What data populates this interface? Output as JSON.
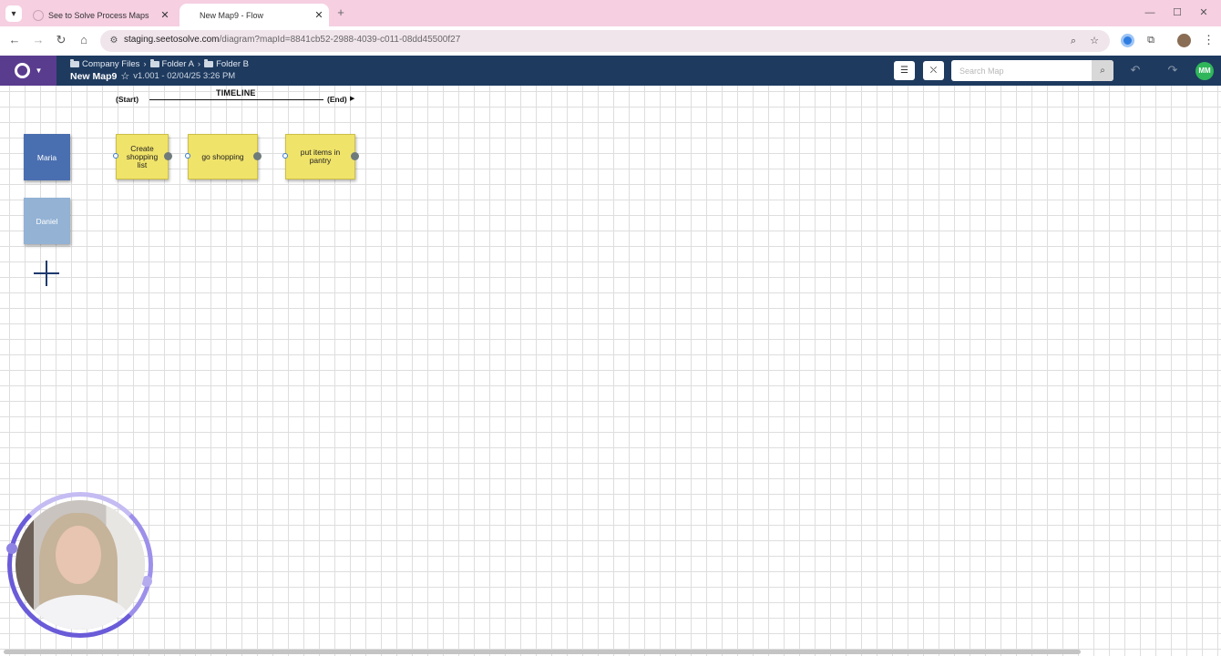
{
  "browser": {
    "tabs": [
      {
        "title": "See to Solve Process Maps",
        "active": false
      },
      {
        "title": "New Map9 - Flow",
        "active": true
      }
    ],
    "url_host": "staging.seetosolve.com",
    "url_path": "/diagram?mapId=8841cb52-2988-4039-c011-08dd45500f27",
    "icons": {
      "tab_menu": "chevron-down-icon",
      "back": "arrow-left-icon",
      "forward": "arrow-right-icon",
      "reload": "reload-icon",
      "home": "home-icon",
      "site_info": "tune-icon",
      "zoom": "magnifier-icon",
      "bookmark": "star-icon",
      "extensions": "puzzle-icon",
      "menu": "kebab-icon"
    }
  },
  "app": {
    "breadcrumb": [
      "Company Files",
      "Folder A",
      "Folder B"
    ],
    "map_title": "New Map9",
    "version": "v1.001 - 02/04/25 3:26 PM",
    "search_placeholder": "Search Map",
    "user_initials": "MM",
    "colors": {
      "header": "#1e3a5f",
      "logo": "#5a3c8f",
      "avatar": "#2fb65a",
      "step": "#f0e36a",
      "lane_primary": "#4a6fb0",
      "lane_secondary": "#93b2d4"
    }
  },
  "canvas": {
    "timeline": {
      "label": "TIMELINE",
      "start": "(Start)",
      "end": "(End)"
    },
    "lanes": [
      {
        "name": "Maria"
      },
      {
        "name": "Daniel"
      }
    ],
    "steps": [
      {
        "text": "Create shopping list"
      },
      {
        "text": "go shopping"
      },
      {
        "text": "put items in pantry"
      }
    ]
  }
}
